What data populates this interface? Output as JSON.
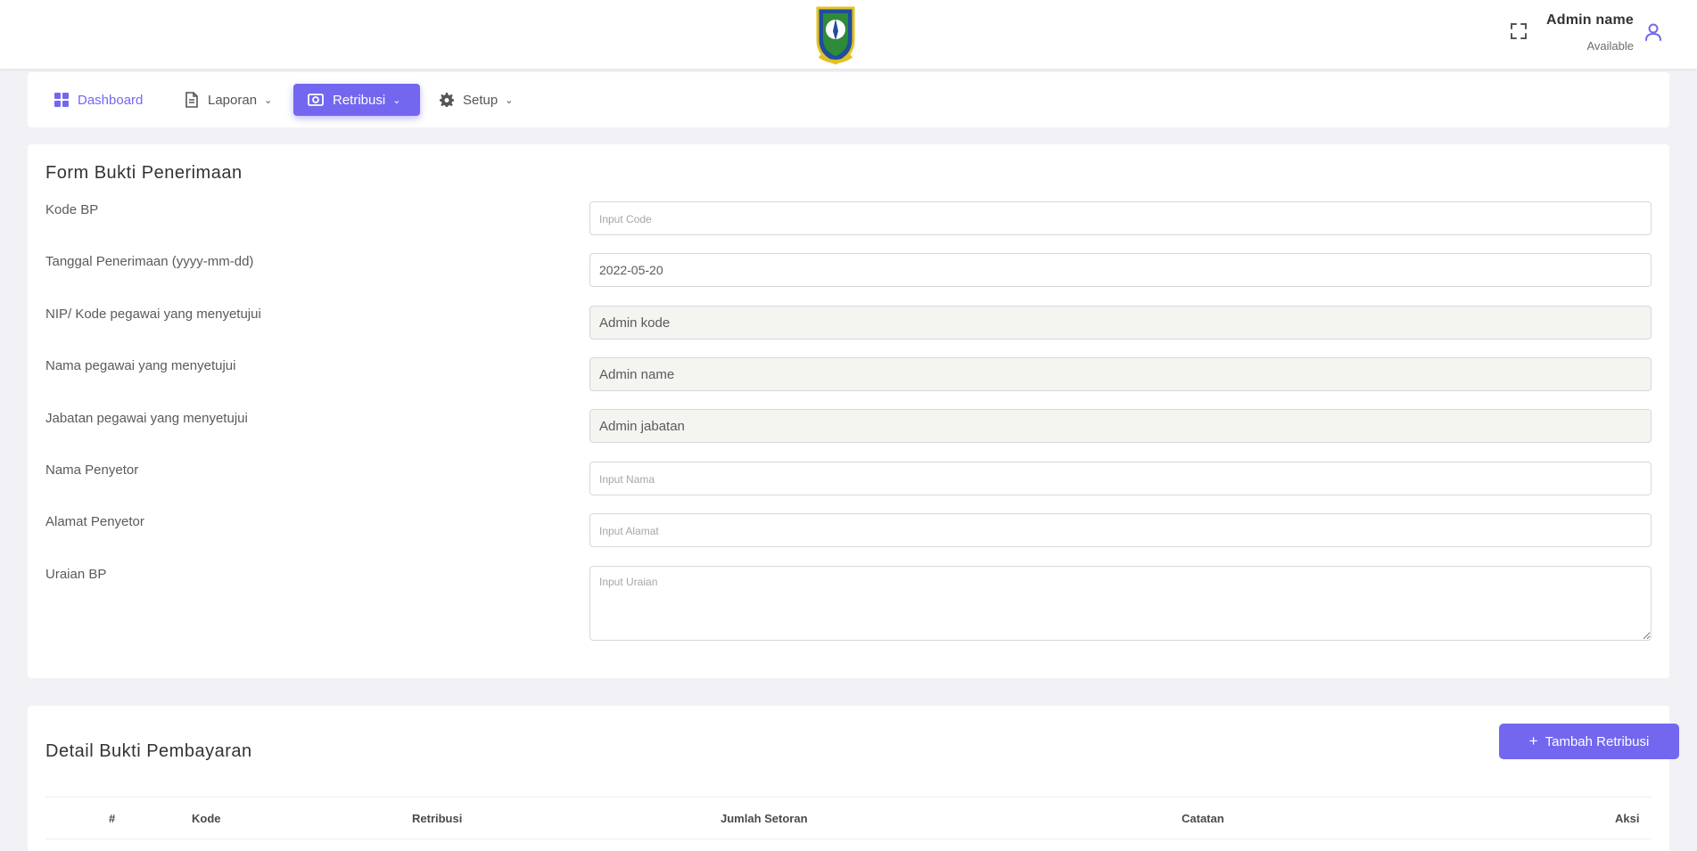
{
  "header": {
    "logo_name": "regional-emblem-logo",
    "user_name": "Admin name",
    "user_status": "Available"
  },
  "nav": {
    "items": [
      {
        "label": "Dashboard",
        "icon": "grid-icon"
      },
      {
        "label": "Laporan",
        "icon": "document-icon"
      },
      {
        "label": "Retribusi",
        "icon": "money-icon",
        "active": true
      },
      {
        "label": "Setup",
        "icon": "gear-icon"
      }
    ]
  },
  "form": {
    "title": "Form Bukti Penerimaan",
    "fields": [
      {
        "label": "Kode BP",
        "value": "",
        "placeholder": "Input Code"
      },
      {
        "label": "Tanggal Penerimaan (yyyy-mm-dd)",
        "value": "2022-05-20",
        "placeholder": ""
      },
      {
        "label": "NIP/ Kode pegawai yang menyetujui",
        "value": "Admin kode",
        "placeholder": ""
      },
      {
        "label": "Nama pegawai yang menyetujui",
        "value": "Admin name",
        "placeholder": ""
      },
      {
        "label": "Jabatan pegawai yang menyetujui",
        "value": "Admin jabatan",
        "placeholder": ""
      },
      {
        "label": "Nama Penyetor",
        "value": "",
        "placeholder": "Input Nama"
      },
      {
        "label": "Alamat Penyetor",
        "value": "",
        "placeholder": "Input Alamat"
      },
      {
        "label": "Uraian BP",
        "value": "",
        "placeholder": "Input Uraian"
      }
    ]
  },
  "detail": {
    "title": "Detail Bukti Pembayaran",
    "add_button_label": "Tambah Retribusi",
    "columns": [
      "#",
      "Kode",
      "Retribusi",
      "Jumlah Setoran",
      "Catatan",
      "Aksi"
    ]
  },
  "colors": {
    "accent": "#7367f0",
    "readonly_bg": "#f4f4f0"
  }
}
